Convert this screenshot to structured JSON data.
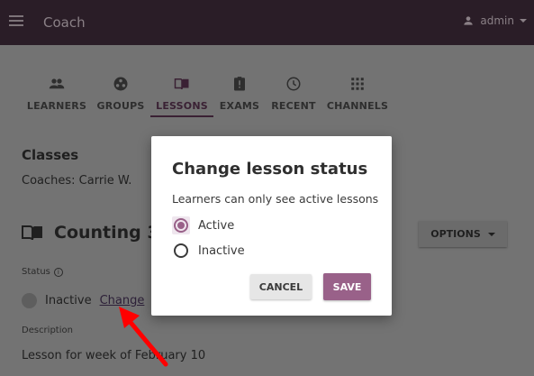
{
  "app_bar": {
    "title": "Coach",
    "user": "admin"
  },
  "tabs": [
    {
      "label": "LEARNERS",
      "icon": "people-icon"
    },
    {
      "label": "GROUPS",
      "icon": "groups-icon"
    },
    {
      "label": "LESSONS",
      "icon": "book-icon",
      "active": true
    },
    {
      "label": "EXAMS",
      "icon": "clipboard-icon"
    },
    {
      "label": "RECENT",
      "icon": "clock-icon"
    },
    {
      "label": "CHANNELS",
      "icon": "grid-icon"
    }
  ],
  "classes": {
    "heading": "Classes",
    "coaches": "Coaches: Carrie W."
  },
  "lesson": {
    "title": "Counting 3",
    "options_label": "OPTIONS",
    "status_label": "Status",
    "status_value": "Inactive",
    "change_label": "Change",
    "description_label": "Description",
    "description": "Lesson for week of February 10"
  },
  "modal": {
    "title": "Change lesson status",
    "subtitle": "Learners can only see active lessons",
    "options": [
      {
        "label": "Active",
        "selected": true
      },
      {
        "label": "Inactive",
        "selected": false
      }
    ],
    "cancel_label": "CANCEL",
    "save_label": "SAVE"
  },
  "colors": {
    "brand": "#996189",
    "appbar": "#2a1d27",
    "annotation_arrow": "#ff0000"
  }
}
